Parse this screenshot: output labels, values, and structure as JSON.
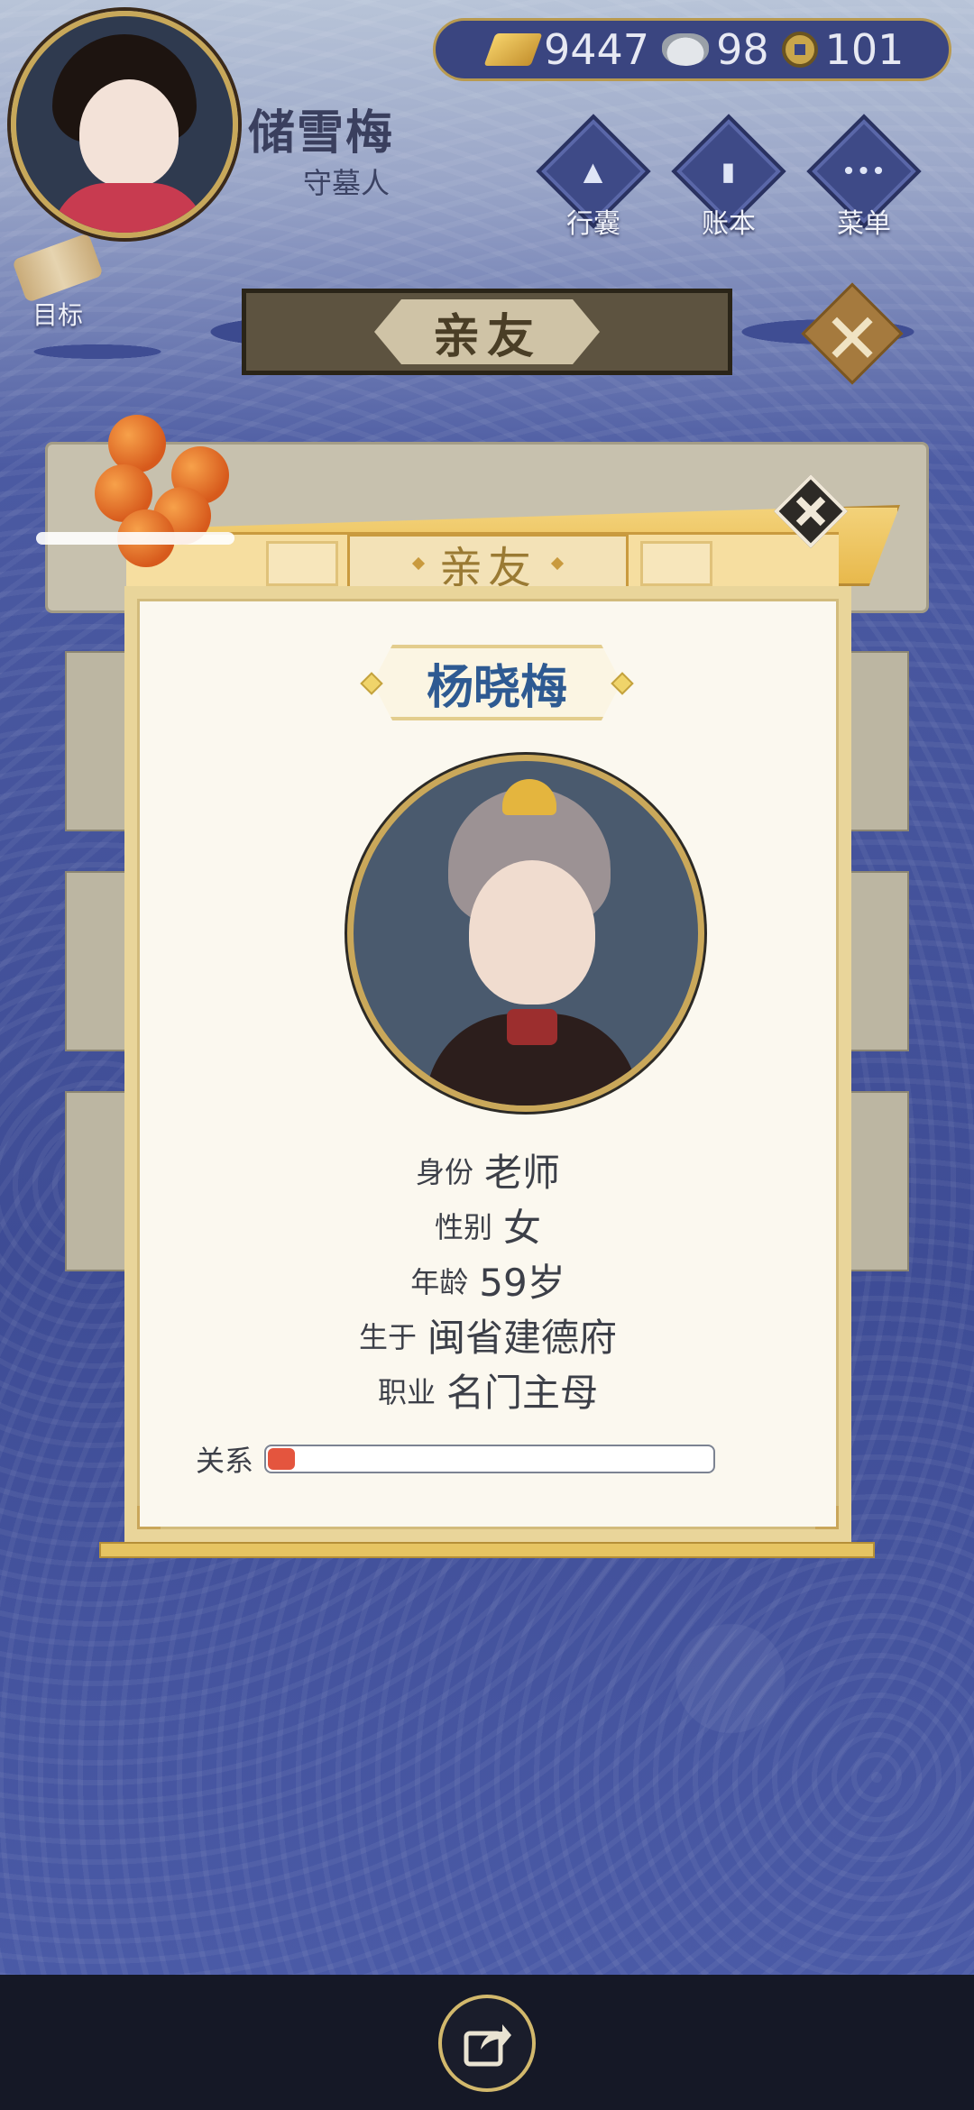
{
  "player": {
    "name": "储雪梅",
    "role": "守墓人"
  },
  "currency": {
    "gold": "9447",
    "silver": "98",
    "copper": "101"
  },
  "menu": {
    "bag": "行囊",
    "ledger": "账本",
    "menu": "菜单",
    "goal": "目标"
  },
  "screen_title": "亲友",
  "dialog": {
    "header": "亲友",
    "person_name": "杨晓梅",
    "fields": [
      {
        "key": "身份",
        "value": "老师"
      },
      {
        "key": "性别",
        "value": "女"
      },
      {
        "key": "年龄",
        "value": "59岁"
      },
      {
        "key": "生于",
        "value": "闽省建德府"
      },
      {
        "key": "职业",
        "value": "名门主母"
      }
    ],
    "relation_label": "关系",
    "relation_fraction": 0.06
  },
  "icons": {
    "share": "share-icon",
    "close": "close-icon"
  },
  "colors": {
    "name_blue": "#2e5a92",
    "relation_fill": "#e4553e",
    "gold_trim": "#c9a65a"
  }
}
